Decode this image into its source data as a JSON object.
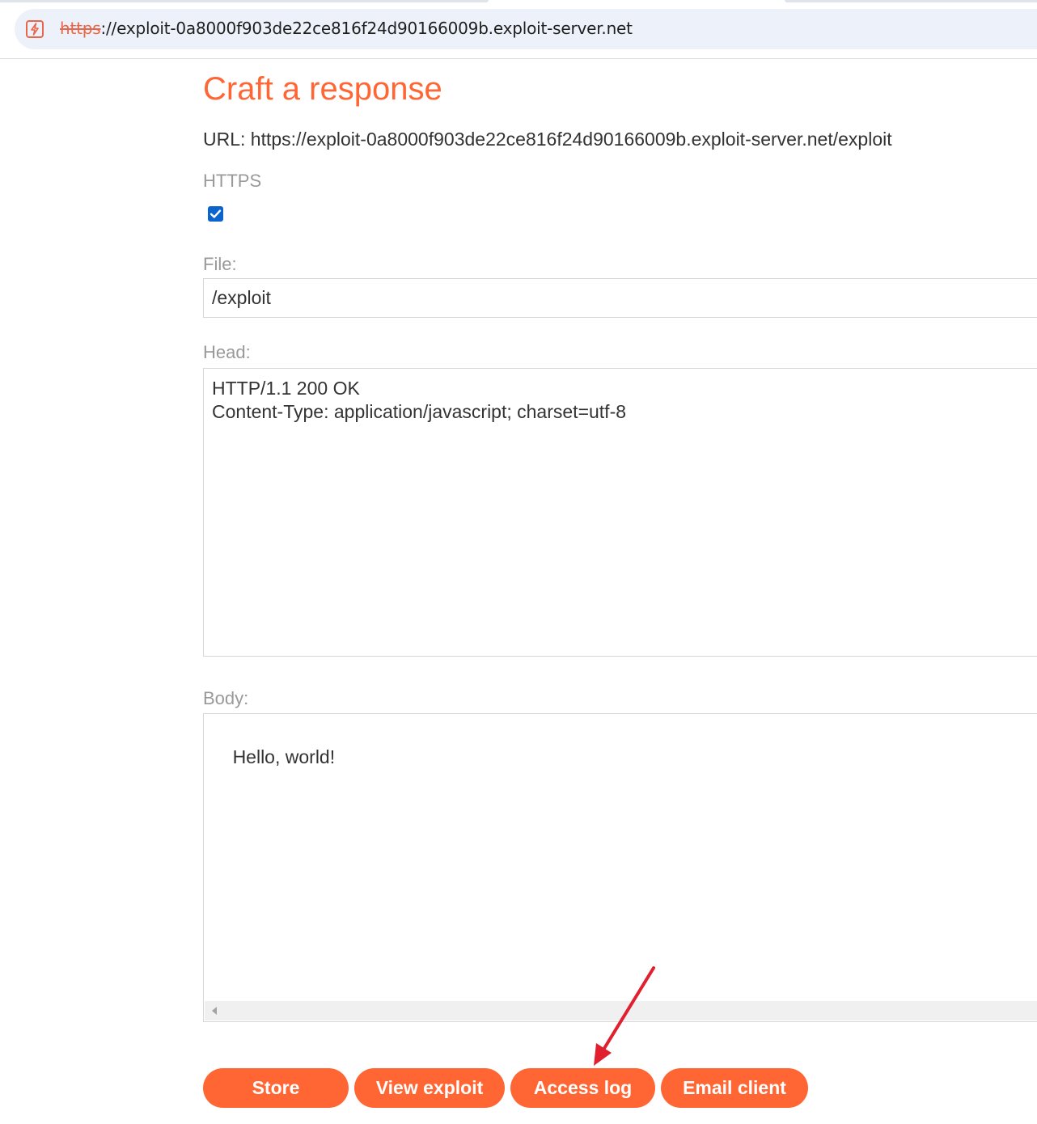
{
  "browser": {
    "url_scheme": "https",
    "url_rest": "://exploit-0a8000f903de22ce816f24d90166009b.exploit-server.net",
    "site_icon": "bolt-icon"
  },
  "page": {
    "title": "Craft a response",
    "url_line": "URL: https://exploit-0a8000f903de22ce816f24d90166009b.exploit-server.net/exploit",
    "https_label": "HTTPS",
    "https_checked": true,
    "file_label": "File:",
    "file_value": "/exploit",
    "head_label": "Head:",
    "head_value": "HTTP/1.1 200 OK\nContent-Type: application/javascript; charset=utf-8",
    "body_label": "Body:",
    "body_value": "Hello, world!"
  },
  "buttons": {
    "store": "Store",
    "view_exploit": "View exploit",
    "access_log": "Access log",
    "email_client": "Email client"
  },
  "colors": {
    "accent": "#ff6633",
    "annotation": "#e0202e",
    "checkbox": "#0b63ce"
  }
}
